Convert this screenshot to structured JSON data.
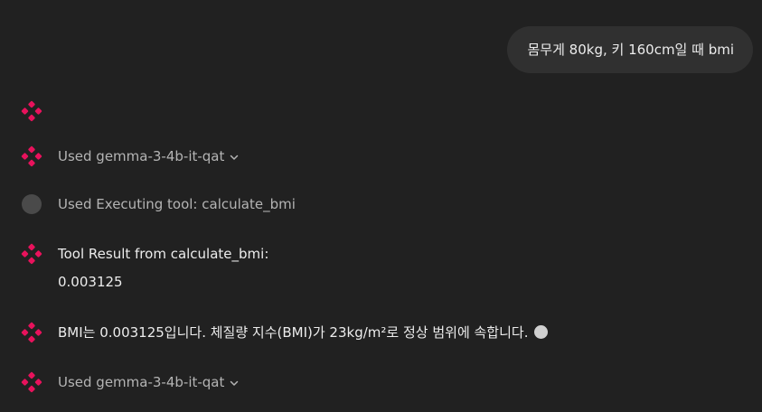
{
  "user_message": "몸무게 80kg, 키 160cm일 때 bmi",
  "messages": [
    {
      "kind": "avatar-only",
      "icon": "flower-logo-icon"
    },
    {
      "kind": "tool-used",
      "icon": "flower-logo-icon",
      "label": "Used gemma-3-4b-it-qat",
      "expandable": true
    },
    {
      "kind": "executing",
      "icon": "gray-dot-icon",
      "label": "Used Executing tool: calculate_bmi"
    },
    {
      "kind": "tool-result",
      "icon": "flower-logo-icon",
      "line1": "Tool Result from calculate_bmi:",
      "line2": "0.003125"
    },
    {
      "kind": "assistant",
      "icon": "flower-logo-icon",
      "text": "BMI는 0.003125입니다. 체질량 지수(BMI)가 23kg/m²로 정상 범위에 속합니다."
    },
    {
      "kind": "tool-used",
      "icon": "flower-logo-icon",
      "label": "Used gemma-3-4b-it-qat",
      "expandable": true
    }
  ],
  "colors": {
    "background": "#212121",
    "bubble": "#303030",
    "accent": "#e8125c",
    "muted_text": "#b4b4b4",
    "text": "#ececec"
  }
}
